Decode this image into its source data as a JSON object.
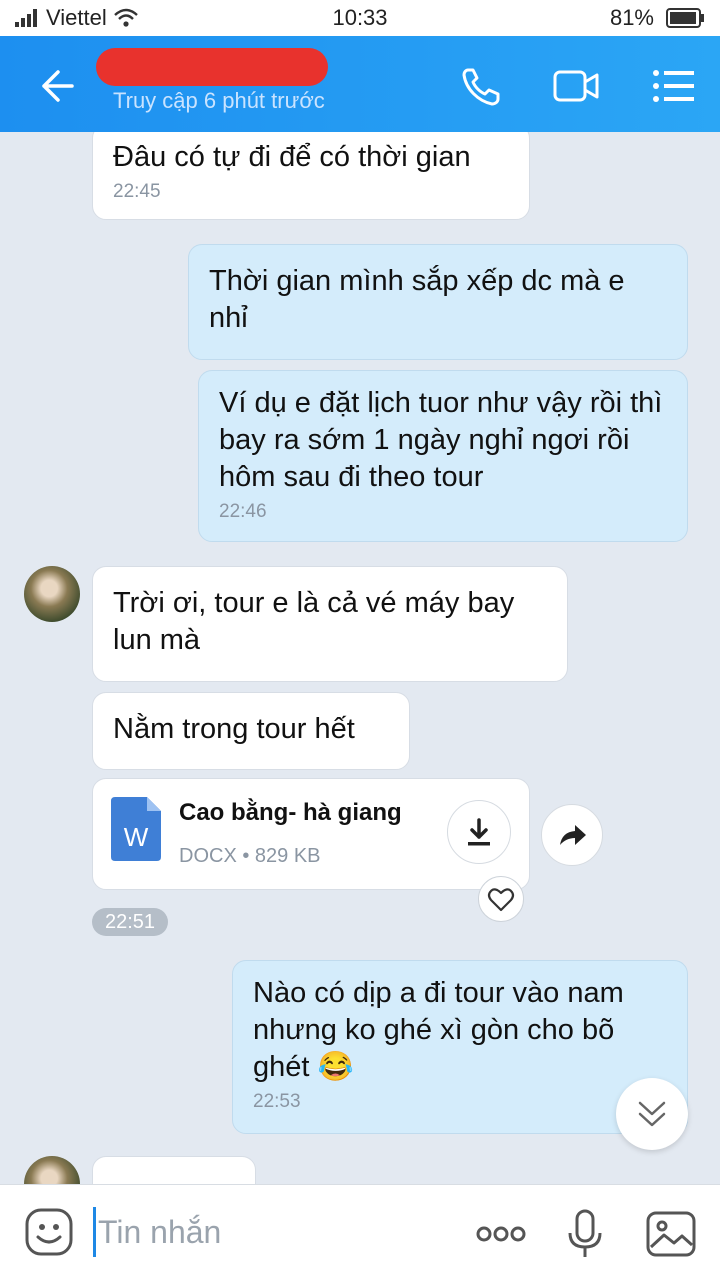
{
  "status_bar": {
    "carrier": "Viettel",
    "time": "10:33",
    "battery": "81%"
  },
  "header": {
    "contact_name": "",
    "last_seen": "Truy cập 6 phút trước"
  },
  "messages": [
    {
      "text": "Đâu có tự đi để có thời gian",
      "time": "22:45"
    },
    {
      "text": "Thời gian mình sắp xếp dc mà e nhỉ"
    },
    {
      "text": "Ví dụ e đặt lịch tuor như vậy rồi thì bay ra sớm 1 ngày nghỉ ngơi rồi hôm sau đi theo tour",
      "time": "22:46"
    },
    {
      "text": "Trời ơi, tour e là cả vé máy bay lun mà"
    },
    {
      "text": "Nằm trong tour hết"
    },
    {
      "text": "Nào có dịp a đi tour vào nam nhưng ko ghé xì gòn cho bõ ghét",
      "emoji": "😂",
      "time": "22:53"
    }
  ],
  "file": {
    "name": "Cao bằng- hà giang",
    "meta": "DOCX • 829 KB",
    "icon_letter": "W",
    "time": "22:51"
  },
  "input": {
    "placeholder": "Tin nhắn"
  },
  "colors": {
    "header": "#1d8ff0",
    "incoming": "#ffffff",
    "outgoing": "#d4ecfb",
    "background": "#e3e9f1"
  }
}
